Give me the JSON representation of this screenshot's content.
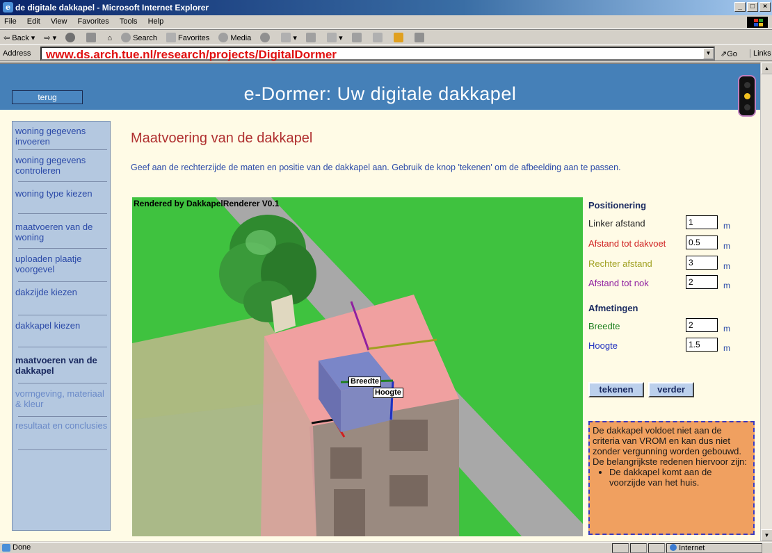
{
  "browser": {
    "window_title": "de digitale dakkapel - Microsoft Internet Explorer",
    "menu": [
      "File",
      "Edit",
      "View",
      "Favorites",
      "Tools",
      "Help"
    ],
    "toolbar": {
      "back": "Back",
      "search": "Search",
      "favorites": "Favorites",
      "media": "Media"
    },
    "address_label": "Address",
    "url": "www.ds.arch.tue.nl/research/projects/DigitalDormer",
    "go_label": "Go",
    "links_label": "Links",
    "status": "Done",
    "zone": "Internet"
  },
  "header": {
    "back_label": "terug",
    "title": "e-Dormer: Uw digitale dakkapel"
  },
  "sidebar": {
    "items": [
      {
        "label": "woning gegevens invoeren",
        "state": "normal"
      },
      {
        "label": "woning gegevens controleren",
        "state": "normal"
      },
      {
        "label": "woning type kiezen",
        "state": "normal"
      },
      {
        "label": "maatvoeren van de woning",
        "state": "normal"
      },
      {
        "label": "uploaden plaatje voorgevel",
        "state": "normal"
      },
      {
        "label": "dakzijde kiezen",
        "state": "normal"
      },
      {
        "label": "dakkapel kiezen",
        "state": "normal"
      },
      {
        "label": "maatvoeren van de dakkapel",
        "state": "active"
      },
      {
        "label": "vormgeving, materiaal & kleur",
        "state": "disabled"
      },
      {
        "label": "resultaat en conclusies",
        "state": "disabled"
      }
    ]
  },
  "main": {
    "title": "Maatvoering van de dakkapel",
    "instruction": "Geef aan de rechterzijde de maten en positie van de dakkapel aan. Gebruik de knop 'tekenen' om de afbeelding aan te passen.",
    "render_caption": "Rendered by DakkapelRenderer V0.1",
    "render_tags": {
      "width": "Breedte",
      "height": "Hoogte"
    }
  },
  "form": {
    "positioning_title": "Positionering",
    "dimensions_title": "Afmetingen",
    "unit": "m",
    "positioning": [
      {
        "label": "Linker afstand",
        "value": "1",
        "color": "#1a1a1a"
      },
      {
        "label": "Afstand tot dakvoet",
        "value": "0.5",
        "color": "#d02020"
      },
      {
        "label": "Rechter afstand",
        "value": "3",
        "color": "#a0a020"
      },
      {
        "label": "Afstand tot nok",
        "value": "2",
        "color": "#9020a0"
      }
    ],
    "dimensions": [
      {
        "label": "Breedte",
        "value": "2",
        "color": "#208020"
      },
      {
        "label": "Hoogte",
        "value": "1.5",
        "color": "#2030c0"
      }
    ],
    "draw_button": "tekenen",
    "next_button": "verder"
  },
  "warning": {
    "text": "De dakkapel voldoet niet aan de criteria van VROM en kan dus niet zonder vergunning worden gebouwd. De belangrijkste redenen hiervoor zijn:",
    "reasons": [
      "De dakkapel komt aan de voorzijde van het huis."
    ]
  },
  "colors": {
    "header_bg": "#4580b8",
    "page_bg": "#fffbe6",
    "sidebar_bg": "#b4c8e0",
    "title_red": "#b03030",
    "link_blue": "#2b4aa8",
    "warning_bg": "#f0a060"
  }
}
